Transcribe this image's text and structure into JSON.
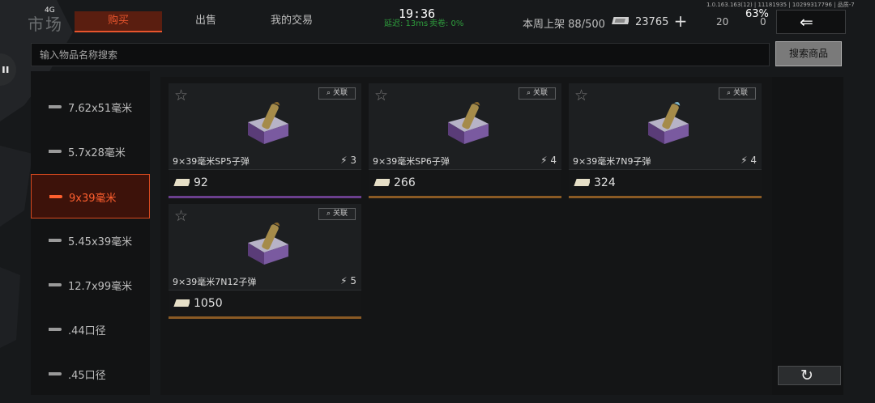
{
  "status_bar": {
    "network": "4G",
    "time": "19:36",
    "latency": "延迟: 13ms",
    "sell_rate": "卖卷: 0%",
    "build": "1.0.163.163(12) | 11181935 | 10299317796 | 品质-7",
    "battery": "63%"
  },
  "header": {
    "logo_text": "市场",
    "tabs": {
      "buy": "购买",
      "sell": "出售",
      "trades": "我的交易"
    },
    "weekly_label": "本周上架",
    "weekly_count": "88/500",
    "money": "23765",
    "plus": "+",
    "res1": "20",
    "res2": "0",
    "back": "⇐"
  },
  "search": {
    "placeholder": "输入物品名称搜索",
    "button": "搜索商品"
  },
  "categories": [
    {
      "label": "7.62x51毫米",
      "active": false
    },
    {
      "label": "5.7x28毫米",
      "active": false
    },
    {
      "label": "9x39毫米",
      "active": true
    },
    {
      "label": "5.45x39毫米",
      "active": false
    },
    {
      "label": "12.7x99毫米",
      "active": false
    },
    {
      "label": ".44口径",
      "active": false
    },
    {
      "label": ".45口径",
      "active": false
    }
  ],
  "items": [
    {
      "name": "9×39毫米SP5子弹",
      "weight": "3",
      "price": "92",
      "link": "关联",
      "rarity_color": "#6b3f8e"
    },
    {
      "name": "9×39毫米SP6子弹",
      "weight": "4",
      "price": "266",
      "link": "关联",
      "rarity_color": "#8a5a24"
    },
    {
      "name": "9×39毫米7N9子弹",
      "weight": "4",
      "price": "324",
      "link": "关联",
      "rarity_color": "#8a5a24"
    },
    {
      "name": "9×39毫米7N12子弹",
      "weight": "5",
      "price": "1050",
      "link": "关联",
      "rarity_color": "#8a5a24"
    }
  ],
  "refresh": "↻",
  "colors": {
    "accent": "#e8552d",
    "active_bg": "#3d120a"
  }
}
